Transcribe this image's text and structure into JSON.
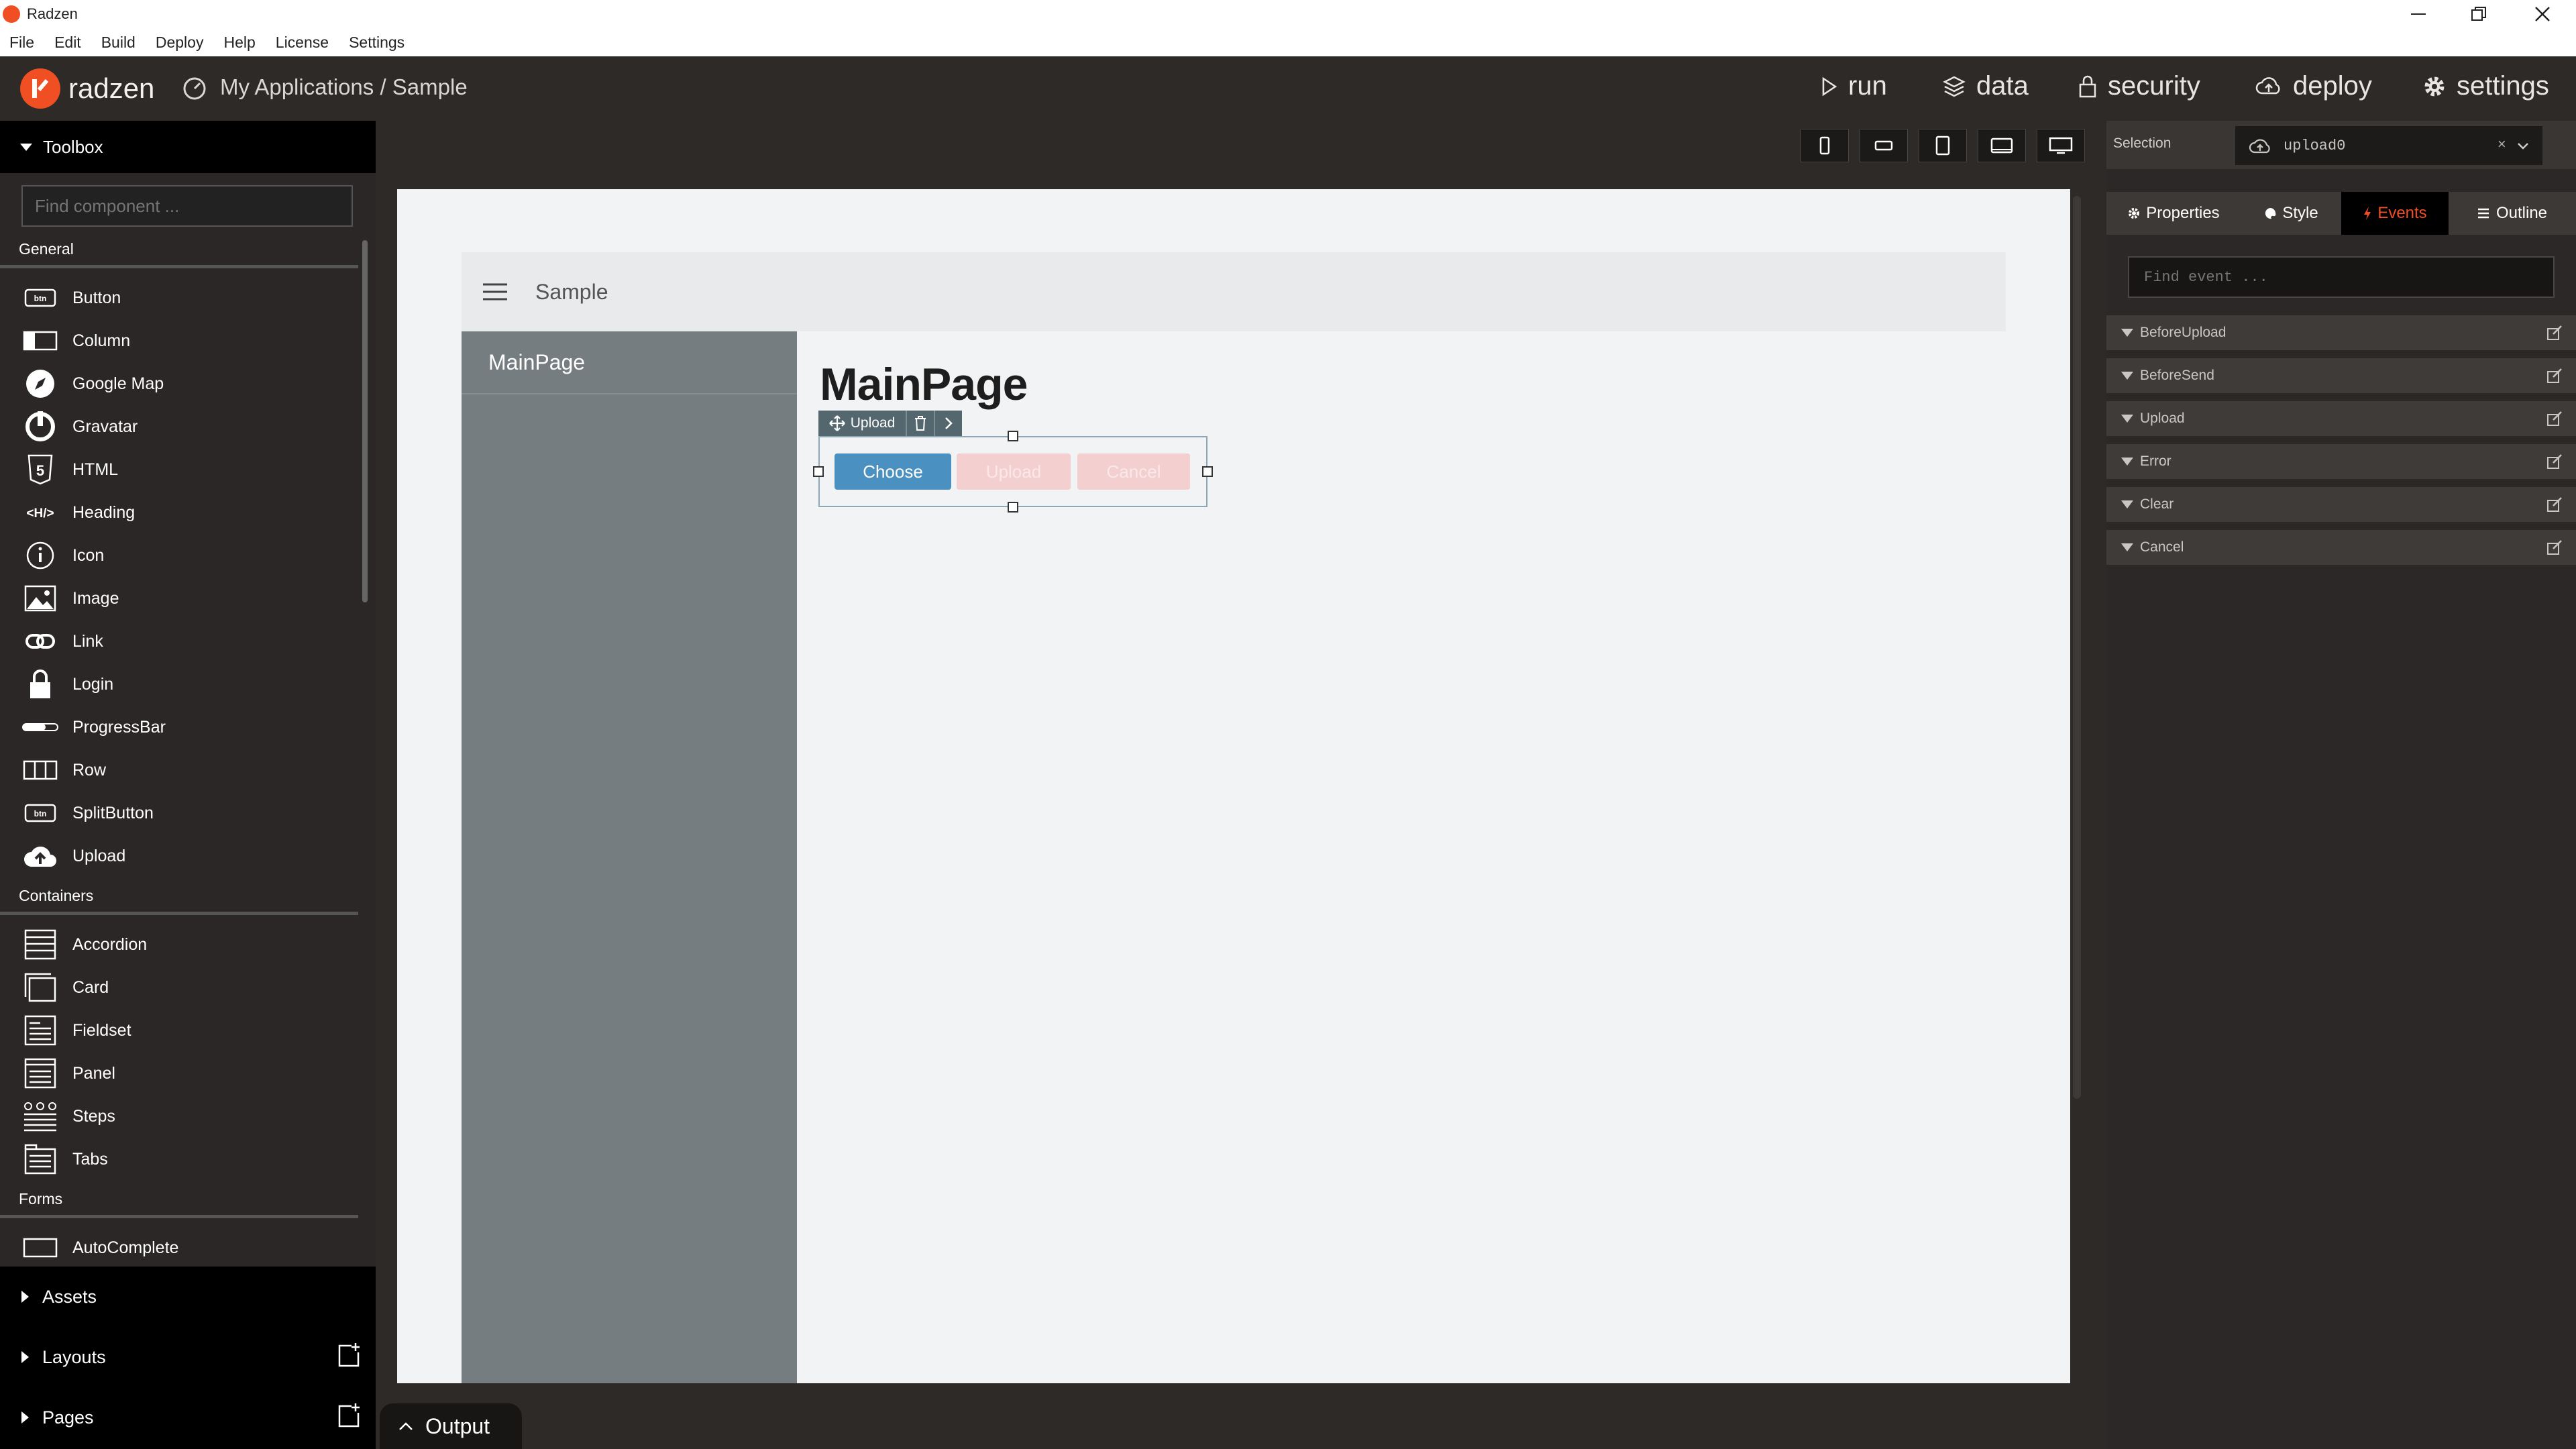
{
  "window": {
    "title": "Radzen"
  },
  "menu": [
    "File",
    "Edit",
    "Build",
    "Deploy",
    "Help",
    "License",
    "Settings"
  ],
  "header": {
    "brand": "radzen",
    "breadcrumb": "My Applications / Sample",
    "nav": [
      {
        "label": "run",
        "icon": "play-icon"
      },
      {
        "label": "data",
        "icon": "layers-icon"
      },
      {
        "label": "security",
        "icon": "lock-icon"
      },
      {
        "label": "deploy",
        "icon": "cloud-upload-icon"
      },
      {
        "label": "settings",
        "icon": "gear-icon"
      }
    ]
  },
  "toolbox": {
    "title": "Toolbox",
    "search_placeholder": "Find component ...",
    "groups": [
      {
        "name": "General",
        "items": [
          "Button",
          "Column",
          "Google Map",
          "Gravatar",
          "HTML",
          "Heading",
          "Icon",
          "Image",
          "Link",
          "Login",
          "ProgressBar",
          "Row",
          "SplitButton",
          "Upload"
        ]
      },
      {
        "name": "Containers",
        "items": [
          "Accordion",
          "Card",
          "Fieldset",
          "Panel",
          "Steps",
          "Tabs"
        ]
      },
      {
        "name": "Forms",
        "items": [
          "AutoComplete"
        ]
      }
    ],
    "bottom": {
      "assets": "Assets",
      "layouts": "Layouts",
      "pages": "Pages"
    }
  },
  "canvas": {
    "app_header_title": "Sample",
    "sidebar_item": "MainPage",
    "page_title": "MainPage",
    "component_toolbar_label": "Upload",
    "buttons": {
      "choose": "Choose",
      "upload": "Upload",
      "cancel": "Cancel"
    }
  },
  "output_label": "Output",
  "right_panel": {
    "selection_label": "Selection",
    "selection_value": "upload0",
    "tabs": [
      "Properties",
      "Style",
      "Events",
      "Outline"
    ],
    "active_tab": "Events",
    "find_event_placeholder": "Find event ...",
    "events": [
      "BeforeUpload",
      "BeforeSend",
      "Upload",
      "Error",
      "Clear",
      "Cancel"
    ]
  },
  "colors": {
    "brand": "#f04e23",
    "choose_button": "#4a90c0",
    "disabled_button": "#f3cfcf"
  }
}
